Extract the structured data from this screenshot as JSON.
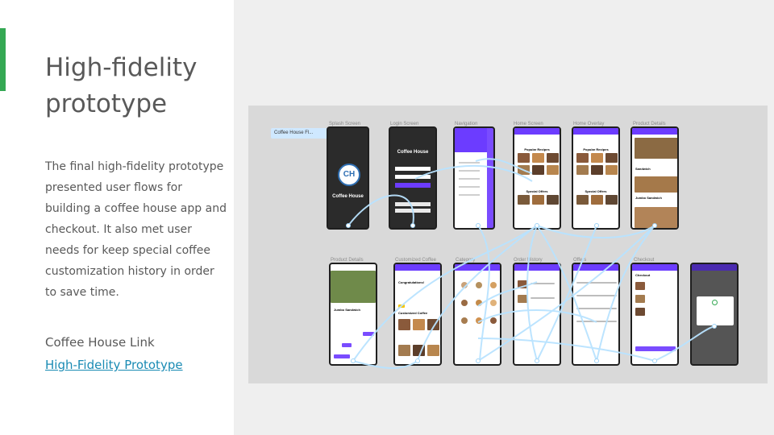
{
  "slide": {
    "title": "High-fidelity prototype",
    "body": "The final high-fidelity prototype presented user flows for building a coffee house app and checkout. It also met user needs for keep special coffee customization history in order to save time.",
    "link_label": "Coffee House Link",
    "link_text": "High-Fidelity Prototype"
  },
  "prototype": {
    "flow_tag": "Coffee House Fl...",
    "row1_labels": [
      "Splash Screen",
      "Login Screen",
      "Navigation",
      "Home Screen",
      "Home Overlay",
      "Product Details"
    ],
    "row2_labels": [
      "Product Details",
      "Customized Coffee",
      "Category",
      "Order History",
      "Offers",
      "Checkout",
      ""
    ],
    "splash_brand": "Coffee House",
    "splash_logo": "CH",
    "login_title": "Coffee House",
    "home_section_1": "Popular Recipes",
    "home_section_2": "Special Offers",
    "overlay_section_1": "Popular Recipes",
    "overlay_section_2": "Special Offers",
    "product_title": "Sandwich",
    "product2_title": "Jumbo Sandwich",
    "customized_greeting": "Congratulations!",
    "customized_heading": "Customized Coffee",
    "checkout_title": "Checkout"
  },
  "colors": {
    "accent_green": "#34a853",
    "brand_purple": "#6c3cff",
    "link_blue": "#1a8bb4"
  }
}
